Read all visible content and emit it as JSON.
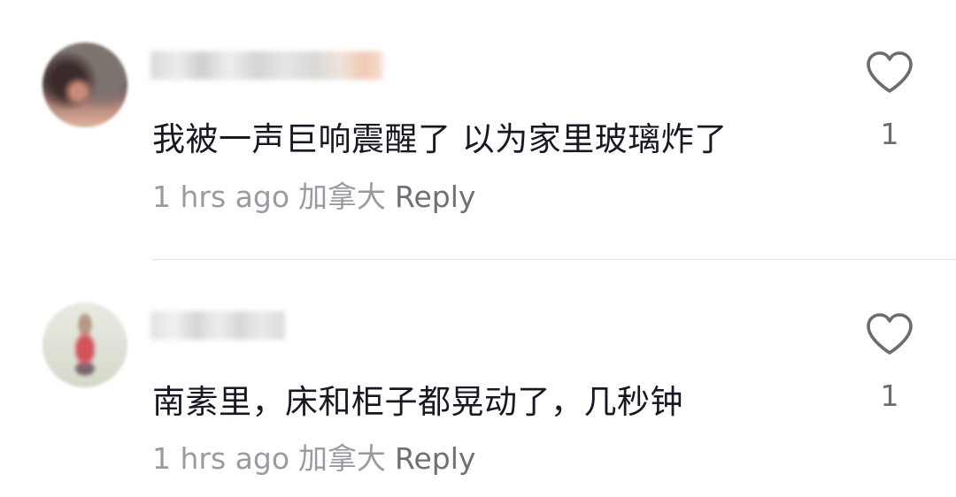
{
  "comments": [
    {
      "text": "我被一声巨响震醒了 以为家里玻璃炸了",
      "time": "1 hrs ago",
      "region": "加拿大",
      "reply_label": "Reply",
      "likes": "1",
      "like_icon": "heart-outline-icon"
    },
    {
      "text": "南素里，床和柜子都晃动了，几秒钟",
      "time": "1 hrs ago",
      "region": "加拿大",
      "reply_label": "Reply",
      "likes": "1",
      "like_icon": "heart-outline-icon"
    }
  ],
  "colors": {
    "text": "#161823",
    "meta": "#9a9ba0",
    "reply": "#6f7075",
    "divider": "#e3e3e4",
    "icon": "#6b6c71"
  }
}
